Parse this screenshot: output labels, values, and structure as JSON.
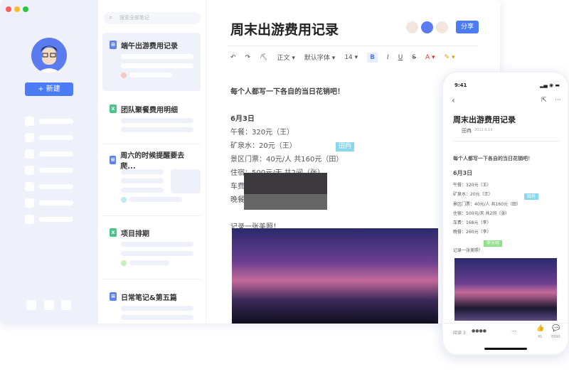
{
  "sidebar": {
    "new_button": "+ 新建"
  },
  "list": {
    "search_placeholder": "搜索全部笔记",
    "items": [
      {
        "title": "端午出游费用记录",
        "type": "doc"
      },
      {
        "title": "团队聚餐费用明细",
        "type": "sheet"
      },
      {
        "title": "周六的时候提醒要去爬...",
        "type": "doc"
      },
      {
        "title": "项目排期",
        "type": "sheet"
      },
      {
        "title": "日常笔记&第五篇",
        "type": "doc"
      }
    ]
  },
  "editor": {
    "title": "周末出游费用记录",
    "share": "分享",
    "toolbar": {
      "style": "正文 ▾",
      "font": "默认字体 ▾",
      "size": "14 ▾",
      "bold": "B",
      "italic": "I",
      "underline": "U",
      "strike": "S",
      "color": "A ▾",
      "highlight": "✎ ▾"
    },
    "intro": "每个人都写一下各自的当日花销吧！",
    "date": "6月3日",
    "lines": [
      "午餐：320元（王）",
      "矿泉水：20元（王）",
      "景区门票：40元/人  共160元（田）",
      "住宿：500元/天  共2间（张）",
      "车费",
      "晚餐"
    ],
    "photo_line": "记录一张美照！",
    "cursor_tag": "田冉"
  },
  "phone": {
    "time": "9:41",
    "title": "周末出游费用记录",
    "author": "田冉",
    "date": "2022.6.19",
    "intro": "每个人都写一下各自的当日花销吧！",
    "date_heading": "6月3日",
    "lines": [
      "午餐：320元（王）",
      "矿泉水：20元（王）",
      "景区门票：40元/人  共160元（田）",
      "住宿：500元/天  共2间（张）",
      "车费：168元（李）",
      "晚餐：260元（李）"
    ],
    "photo_line": "记录一张美照！",
    "tag1": "田冉",
    "tag2": "李大明",
    "read": "阅读 3",
    "likes": "45",
    "comments": "8990"
  },
  "colors": {
    "accent": "#4c7cf5"
  }
}
